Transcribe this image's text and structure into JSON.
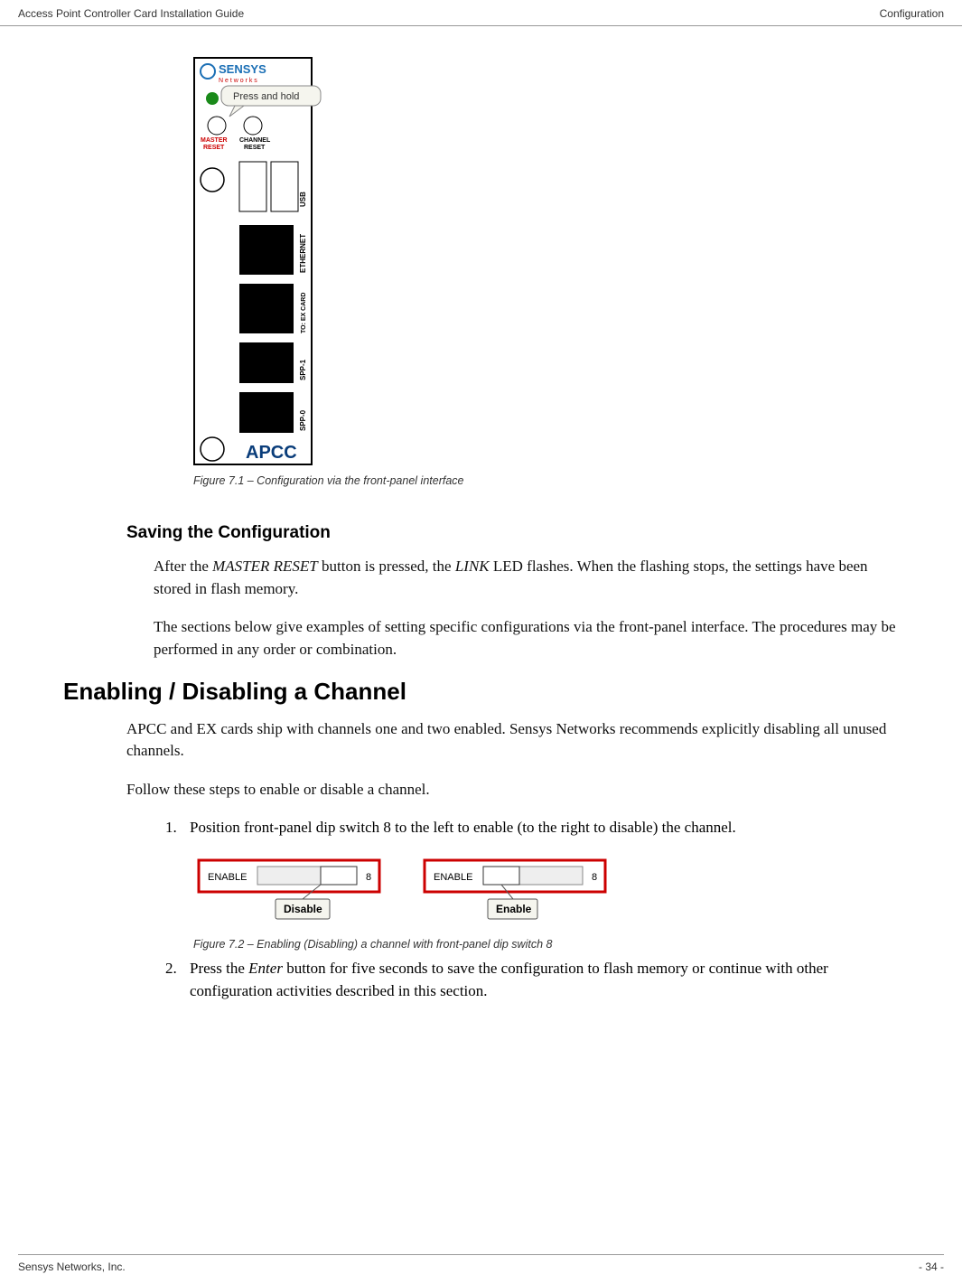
{
  "header": {
    "left": "Access Point Controller Card Installation Guide",
    "right": "Configuration"
  },
  "device": {
    "brand_top": "SENSYS",
    "brand_sub": "N e t w o r k s",
    "tooltip": "Press and hold",
    "master_reset_top": "MASTER",
    "master_reset_bottom": "RESET",
    "channel_reset_top": "CHANNEL",
    "channel_reset_bottom": "RESET",
    "port_usb": "USB",
    "port_eth": "ETHERNET",
    "port_ex": "TO: EX CARD",
    "port_spp1": "SPP-1",
    "port_spp0": "SPP-0",
    "logo": "APCC"
  },
  "fig1_caption": "Figure 7.1 – Configuration via the front-panel interface",
  "h3_saving": "Saving the Configuration",
  "p_after_master_1": "After the ",
  "p_after_master_em1": "MASTER RESET",
  "p_after_master_2": " button is pressed, the ",
  "p_after_master_em2": "LINK",
  "p_after_master_3": " LED flashes. When the flashing stops, the settings have been stored in flash memory.",
  "p_sections_below": "The sections below give examples of setting specific configurations via the front-panel interface. The procedures may be performed in any order or combination.",
  "h2_enabling": "Enabling / Disabling a Channel",
  "p_apcc_ex": "APCC and EX cards ship with channels one and two enabled. Sensys Networks recommends explicitly disabling all unused channels.",
  "p_follow": "Follow these steps to enable or disable a channel.",
  "step1": "Position front-panel dip switch 8 to the left to enable (to the right to disable) the channel.",
  "dip": {
    "label_enable": "ENABLE",
    "num": "8",
    "btn_disable": "Disable",
    "btn_enable": "Enable"
  },
  "fig2_caption": "Figure 7.2 – Enabling (Disabling) a channel with front-panel dip switch 8",
  "step2_a": "Press the ",
  "step2_em": "Enter",
  "step2_b": " button for five seconds to save the configuration to flash memory or continue with other configuration activities described in this section.",
  "footer": {
    "left": "Sensys Networks, Inc.",
    "right": "- 34 -"
  }
}
